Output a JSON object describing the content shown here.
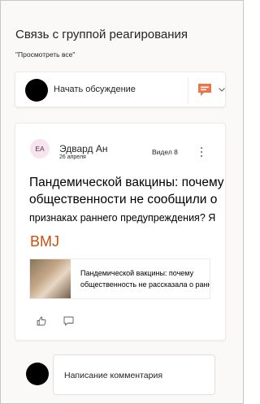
{
  "header": {
    "title": "Связь с группой реагирования",
    "see_all": "\"Просмотреть все\""
  },
  "composer": {
    "label": "Начать обсуждение",
    "chat_icon": "chat-bubble-icon",
    "chevron_icon": "chevron-down-icon",
    "colors": {
      "chat_icon": "#e97548"
    }
  },
  "post": {
    "avatar_initials": "EA",
    "author": "Эдвард Ан",
    "date": "26 апреля",
    "seen": "Видел 8",
    "headline_line1": "Пандемической вакцины: почему",
    "headline_line2": "общественности не сообщили о",
    "headline_line3": "признаках раннего предупреждения? Я",
    "source": "BMJ",
    "link_preview": {
      "title_line1": "Пандемической вакцины: почему",
      "title_line2": "общественность не рассказала о ранней"
    },
    "actions": {
      "like_icon": "like-icon",
      "comment_icon": "comment-icon"
    }
  },
  "reply": {
    "placeholder": "Написание комментария"
  },
  "colors": {
    "accent": "#ca5010",
    "avatar_bg": "#f6e4ee"
  }
}
